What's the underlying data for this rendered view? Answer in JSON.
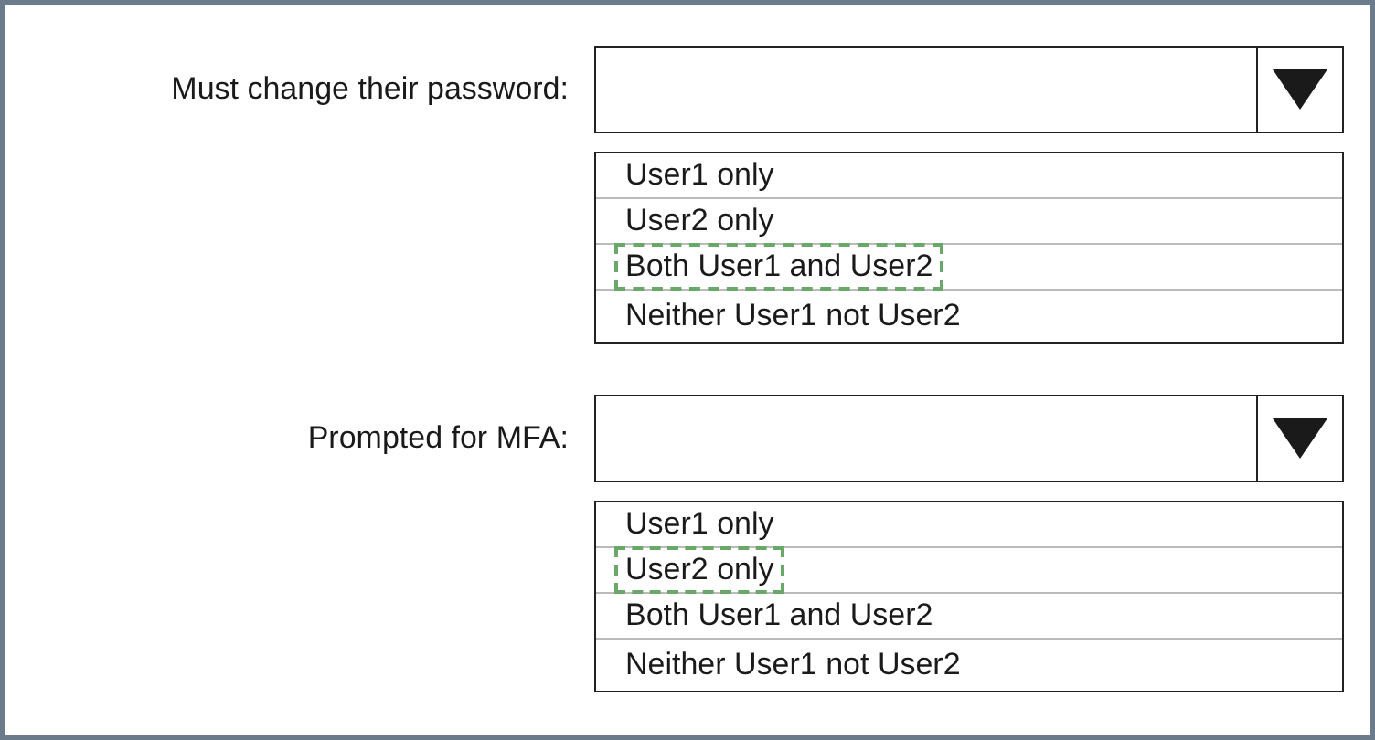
{
  "questions": [
    {
      "label": "Must change their password:",
      "options": [
        {
          "text": "User1 only",
          "selected": false
        },
        {
          "text": "User2 only",
          "selected": false
        },
        {
          "text": "Both User1 and User2",
          "selected": true
        },
        {
          "text": "Neither User1 not User2",
          "selected": false
        }
      ]
    },
    {
      "label": "Prompted for MFA:",
      "options": [
        {
          "text": "User1 only",
          "selected": false
        },
        {
          "text": "User2 only",
          "selected": true
        },
        {
          "text": "Both User1 and User2",
          "selected": false
        },
        {
          "text": "Neither User1 not User2",
          "selected": false
        }
      ]
    }
  ]
}
